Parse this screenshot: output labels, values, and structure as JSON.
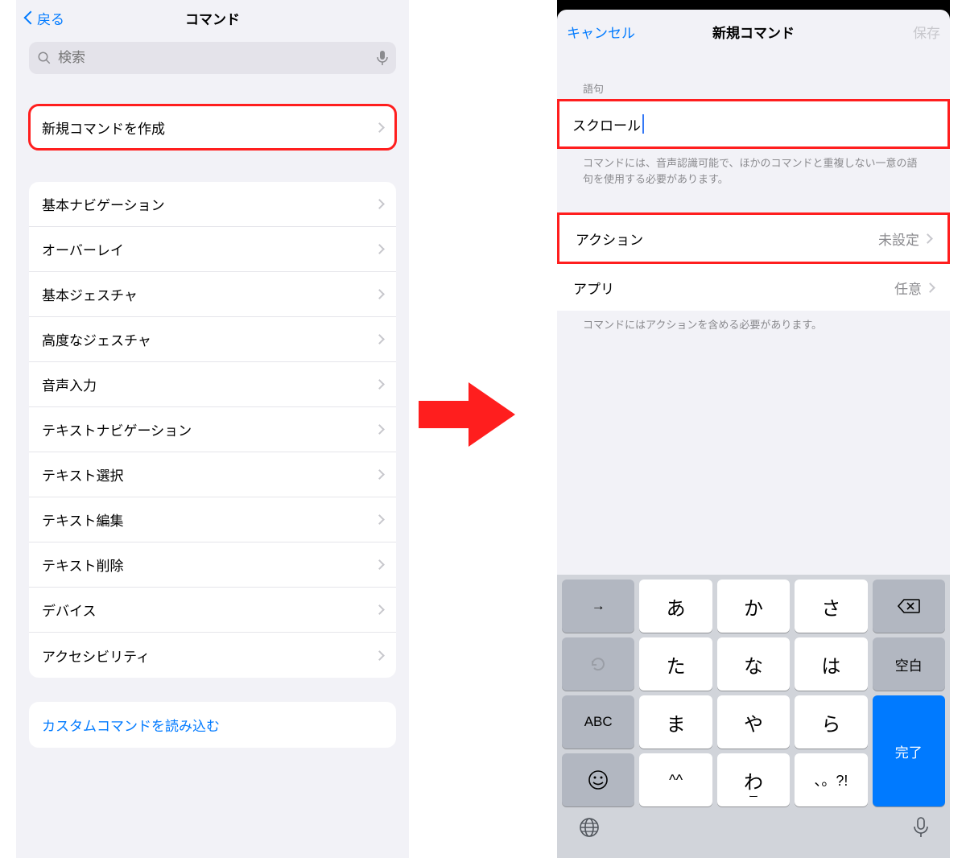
{
  "left": {
    "back_label": "戻る",
    "title": "コマンド",
    "search_placeholder": "検索",
    "create_label": "新規コマンドを作成",
    "categories": [
      "基本ナビゲーション",
      "オーバーレイ",
      "基本ジェスチャ",
      "高度なジェスチャ",
      "音声入力",
      "テキストナビゲーション",
      "テキスト選択",
      "テキスト編集",
      "テキスト削除",
      "デバイス",
      "アクセシビリティ"
    ],
    "import_label": "カスタムコマンドを読み込む"
  },
  "right": {
    "cancel_label": "キャンセル",
    "title": "新規コマンド",
    "save_label": "保存",
    "section_phrase": "語句",
    "phrase_value": "スクロール",
    "phrase_note": "コマンドには、音声認識可能で、ほかのコマンドと重複しない一意の語句を使用する必要があります。",
    "action_label": "アクション",
    "action_value": "未設定",
    "app_label": "アプリ",
    "app_value": "任意",
    "action_note": "コマンドにはアクションを含める必要があります。",
    "keyboard": {
      "grid": [
        "→",
        "あ",
        "か",
        "さ",
        "⌫",
        "↺",
        "た",
        "な",
        "は",
        "空白",
        "ABC",
        "ま",
        "や",
        "ら",
        "完了",
        "☺",
        "^^",
        "わ",
        "、。?!"
      ],
      "globe": "🌐",
      "mic": "🎤"
    }
  }
}
